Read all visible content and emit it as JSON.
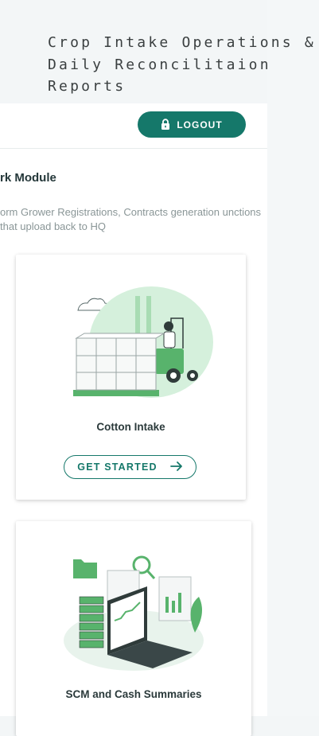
{
  "header": {
    "title": "Crop Intake Operations & Daily Reconcilitaion Reports"
  },
  "topbar": {
    "logout_label": "LOGOUT",
    "logout_icon": "lock-icon"
  },
  "module": {
    "title": "rk Module",
    "description": "orm Grower Registrations, Contracts generation unctions that upload back to HQ"
  },
  "cards": [
    {
      "label": "Cotton Intake",
      "button_label": "GET STARTED",
      "button_icon": "arrow-right-icon",
      "illustration": "forklift-illustration"
    },
    {
      "label": "SCM and Cash Summaries",
      "illustration": "analytics-laptop-illustration"
    }
  ],
  "colors": {
    "brand": "#15786a",
    "accent_light": "#c8eccf",
    "accent_mid": "#58b36c",
    "background": "#f3f6f7"
  }
}
